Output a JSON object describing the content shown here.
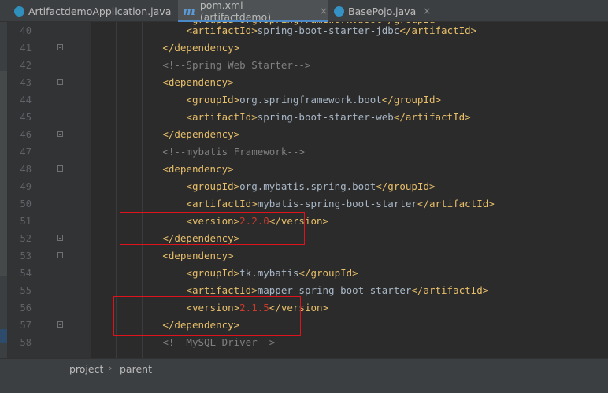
{
  "tabs": [
    {
      "label": "ArtifactdemoApplication.java",
      "icon": "spring-boot-class-icon",
      "active": false
    },
    {
      "label": "pom.xml (artifactdemo)",
      "icon": "maven-m-icon",
      "active": true
    },
    {
      "label": "BasePojo.java",
      "icon": "class-icon",
      "active": false
    }
  ],
  "tab_close_glyph": "×",
  "m_glyph": "m",
  "editor": {
    "lines": [
      {
        "num": "40",
        "indent": "                ",
        "open": "<artifactId>",
        "text": "spring-boot-starter-jdbc",
        "close": "</artifactId>"
      },
      {
        "num": "41",
        "indent": "            ",
        "open": "</dependency>"
      },
      {
        "num": "42",
        "indent": "            ",
        "comment": "<!--Spring Web Starter-->"
      },
      {
        "num": "43",
        "indent": "            ",
        "open": "<dependency>"
      },
      {
        "num": "44",
        "indent": "                ",
        "open": "<groupId>",
        "text": "org.springframework.boot",
        "close": "</groupId>"
      },
      {
        "num": "45",
        "indent": "                ",
        "open": "<artifactId>",
        "text": "spring-boot-starter-web",
        "close": "</artifactId>"
      },
      {
        "num": "46",
        "indent": "            ",
        "open": "</dependency>"
      },
      {
        "num": "47",
        "indent": "            ",
        "comment": "<!--mybatis Framework-->"
      },
      {
        "num": "48",
        "indent": "            ",
        "open": "<dependency>"
      },
      {
        "num": "49",
        "indent": "                ",
        "open": "<groupId>",
        "text": "org.mybatis.spring.boot",
        "close": "</groupId>"
      },
      {
        "num": "50",
        "indent": "                ",
        "open": "<artifactId>",
        "text": "mybatis-spring-boot-starter",
        "close": "</artifactId>"
      },
      {
        "num": "51",
        "indent": "                ",
        "open": "<version>",
        "version": "2.2.0",
        "close": "</version>"
      },
      {
        "num": "52",
        "indent": "            ",
        "open": "</dependency>"
      },
      {
        "num": "53",
        "indent": "            ",
        "open": "<dependency>"
      },
      {
        "num": "54",
        "indent": "                ",
        "open": "<groupId>",
        "text": "tk.mybatis",
        "close": "</groupId>"
      },
      {
        "num": "55",
        "indent": "                ",
        "open": "<artifactId>",
        "text": "mapper-spring-boot-starter",
        "close": "</artifactId>"
      },
      {
        "num": "56",
        "indent": "                ",
        "open": "<version>",
        "version": "2.1.5",
        "close": "</version>"
      },
      {
        "num": "57",
        "indent": "            ",
        "open": "</dependency>"
      },
      {
        "num": "58",
        "indent": "            ",
        "comment": "<!--MySQL Driver-->"
      }
    ],
    "partial_top_line": "                <groupId>org.springframework.boot</groupId>"
  },
  "breadcrumb": [
    "project",
    "parent"
  ],
  "breadcrumb_sep": "›",
  "colors": {
    "tag": "#e8bf6a",
    "text": "#a9b7c6",
    "comment": "#808080",
    "version": "#cc3a2c",
    "highlight": "#e0121b"
  }
}
